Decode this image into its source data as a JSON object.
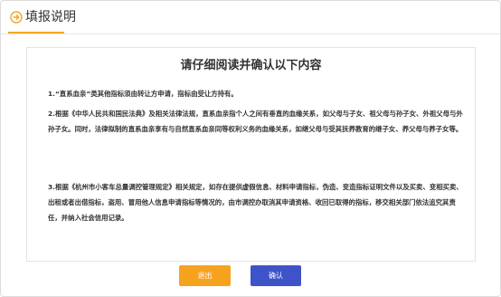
{
  "header": {
    "icon": "arrow-right-circle-icon",
    "title": "填报说明",
    "accent_color": "#f5a623"
  },
  "notice": {
    "title": "请仔细阅读并确认以下内容",
    "paragraphs": [
      "1.“直系血亲”类其他指标须由转让方申请，指标由受让方持有。",
      "2.根据《中华人民共和国民法典》及相关法律法规，直系血亲指个人之间有垂直的血缘关系，如父母与子女、祖父母与孙子女、外祖父母与外孙子女。同时，法律拟制的直系血亲享有与自然直系血亲同等权利义务的血缘关系，如继父母与受其抚养教育的继子女、养父母与养子女等。",
      "3.根据《杭州市小客车总量调控管理规定》相关规定，如存在提供虚假信息、材料申请指标，伪造、变造指标证明文件以及买卖、变相买卖、出租或者出借指标，盗用、冒用他人信息申请指标等情况的，由市调控办取消其申请资格、收回已取得的指标，移交相关部门依法追究其责任，并纳入社会信用记录。"
    ]
  },
  "buttons": {
    "back_label": "退出",
    "back_color": "#f7a21e",
    "confirm_label": "确认",
    "confirm_color": "#3f53c9"
  }
}
